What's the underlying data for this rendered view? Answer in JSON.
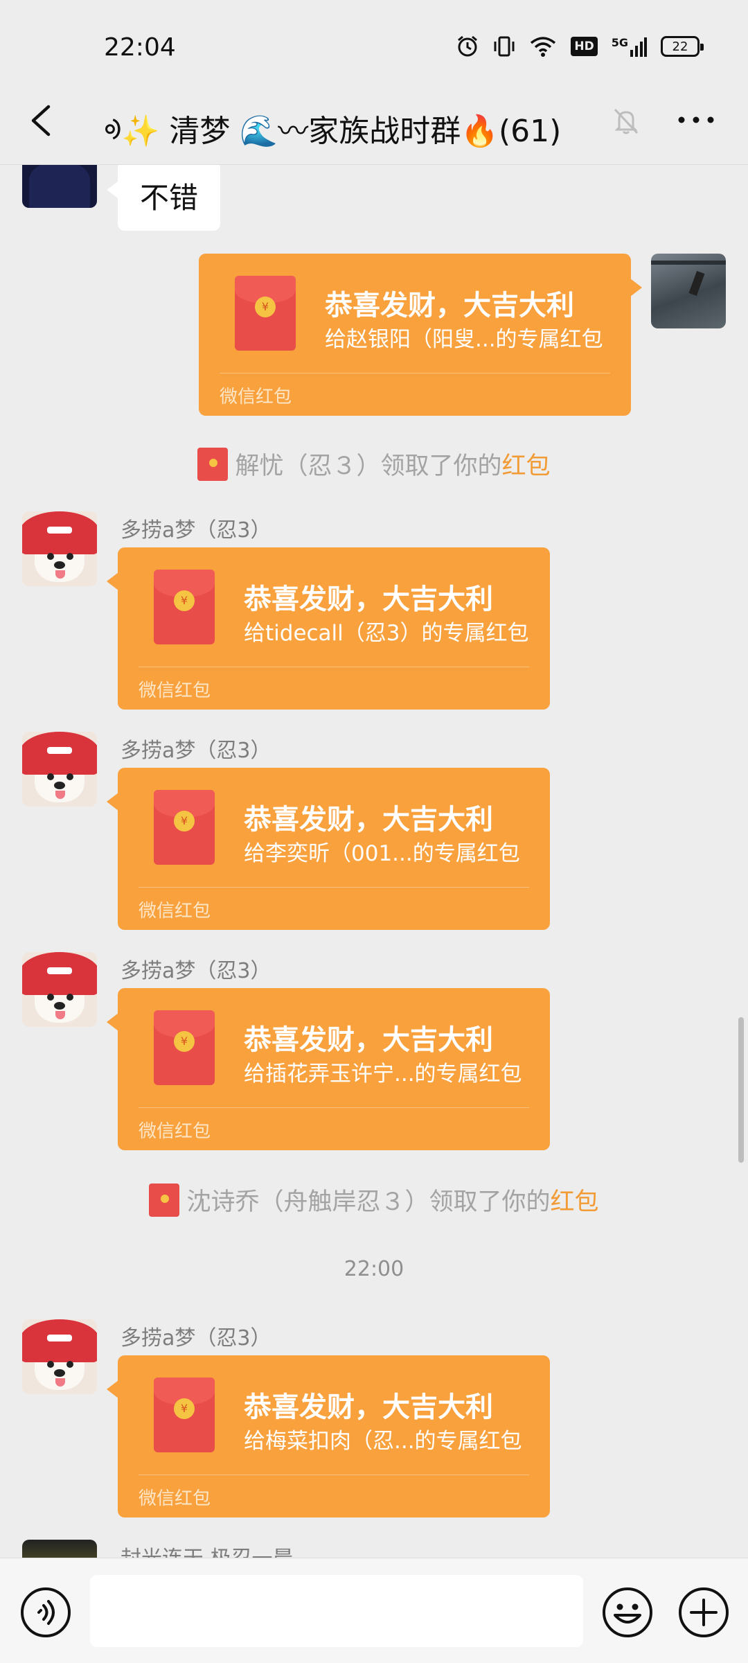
{
  "status_bar": {
    "time": "22:04",
    "battery": "22",
    "signal_label": "5G",
    "hd_label": "HD"
  },
  "header": {
    "title": "ᢀ✨ 清梦 🌊〰家族战时群🔥(61)",
    "icons": [
      "back-arrow-icon",
      "mute-bell-icon",
      "more-icon"
    ]
  },
  "messages": {
    "text_msg": "不错",
    "rp_footer": "微信红包",
    "rp1": {
      "title": "恭喜发财，大吉大利",
      "sub": "给赵银阳（阳叟...的专属红包"
    },
    "sys1": {
      "before": "解忧（忍３）领取了你的",
      "link": "红包"
    },
    "rp2": {
      "sender": "多捞a梦（忍3）",
      "title": "恭喜发财，大吉大利",
      "sub": "给tidecall（忍3）的专属红包"
    },
    "rp3": {
      "sender": "多捞a梦（忍3）",
      "title": "恭喜发财，大吉大利",
      "sub": "给李奕昕（001...的专属红包"
    },
    "rp4": {
      "sender": "多捞a梦（忍3）",
      "title": "恭喜发财，大吉大利",
      "sub": "给插花弄玉许宁...的专属红包"
    },
    "sys2": {
      "before": "沈诗乔（舟触岸忍３）领取了你的",
      "link": "红包"
    },
    "timestamp": "22:00",
    "rp5": {
      "sender": "多捞a梦（忍3）",
      "title": "恭喜发财，大吉大利",
      "sub": "给梅菜扣肉（忍...的专属红包"
    },
    "partial_sender": "封光连天 极忍一晨"
  },
  "input_bar": {
    "placeholder": "",
    "icons": [
      "voice-icon",
      "emoji-icon",
      "plus-icon"
    ]
  },
  "colors": {
    "background": "#ededed",
    "redpacket": "#f8a13d",
    "envelope": "#e94d4a",
    "link": "#f29b35"
  }
}
